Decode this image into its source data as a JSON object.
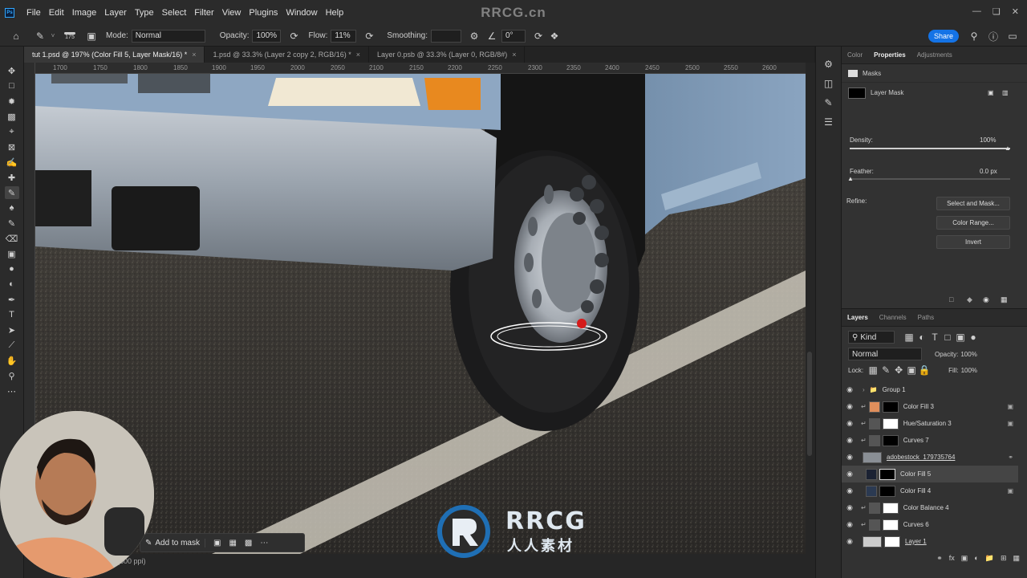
{
  "app": {
    "menu": [
      "File",
      "Edit",
      "Image",
      "Layer",
      "Type",
      "Select",
      "Filter",
      "View",
      "Plugins",
      "Window",
      "Help"
    ],
    "watermark_top": "RRCG.cn"
  },
  "options": {
    "brush_size": "175",
    "mode_label": "Mode:",
    "mode_value": "Normal",
    "opacity_label": "Opacity:",
    "opacity_value": "100%",
    "flow_label": "Flow:",
    "flow_value": "11%",
    "smoothing_label": "Smoothing:",
    "angle_value": "0°",
    "share_label": "Share"
  },
  "tabs": [
    {
      "label": "tut 1.psd @ 197% (Color Fill 5, Layer Mask/16) *",
      "active": true
    },
    {
      "label": "1.psd @ 33.3% (Layer 2 copy 2, RGB/16) *",
      "active": false
    },
    {
      "label": "Layer 0.psb @ 33.3% (Layer 0, RGB/8#)",
      "active": false
    }
  ],
  "ruler_ticks": [
    "1700",
    "1750",
    "1800",
    "1850",
    "1900",
    "1950",
    "2000",
    "2050",
    "2100",
    "2150",
    "2200",
    "2250",
    "2300",
    "2350",
    "2400",
    "2450",
    "2500",
    "2550",
    "2600"
  ],
  "status": {
    "text": "(300 ppi)"
  },
  "mask_bar": {
    "add_label": "Add to mask"
  },
  "brand": {
    "line1": "RRCG",
    "line2": "人人素材"
  },
  "properties": {
    "tabs": [
      "Color",
      "Properties",
      "Adjustments"
    ],
    "masks_label": "Masks",
    "layer_mask_label": "Layer Mask",
    "density_label": "Density:",
    "density_value": "100%",
    "feather_label": "Feather:",
    "feather_value": "0.0 px",
    "refine_label": "Refine:",
    "btn_select_mask": "Select and Mask...",
    "btn_color_range": "Color Range...",
    "btn_invert": "Invert",
    "density_level": 1.0,
    "feather_level": 0.0
  },
  "layers": {
    "tabs": [
      "Layers",
      "Channels",
      "Paths"
    ],
    "kind_label": "Kind",
    "blend_mode": "Normal",
    "opacity_label": "Opacity:",
    "opacity_value": "100%",
    "lock_label": "Lock:",
    "fill_label": "Fill:",
    "fill_value": "100%",
    "items": [
      {
        "name": "Group 1",
        "type": "group"
      },
      {
        "name": "Color Fill 3",
        "type": "fill"
      },
      {
        "name": "Hue/Saturation 3",
        "type": "adj"
      },
      {
        "name": "Curves 7",
        "type": "adj"
      },
      {
        "name": "adobestock_179735764",
        "type": "smart"
      },
      {
        "name": "Color Fill 5",
        "type": "fill",
        "selected": true
      },
      {
        "name": "Color Fill 4",
        "type": "fill"
      },
      {
        "name": "Color Balance 4",
        "type": "adj"
      },
      {
        "name": "Curves 6",
        "type": "adj"
      },
      {
        "name": "Layer 1",
        "type": "pixel"
      }
    ]
  },
  "colors": {
    "accent": "#1473e6",
    "panel": "#323232",
    "selected": "#454545"
  }
}
